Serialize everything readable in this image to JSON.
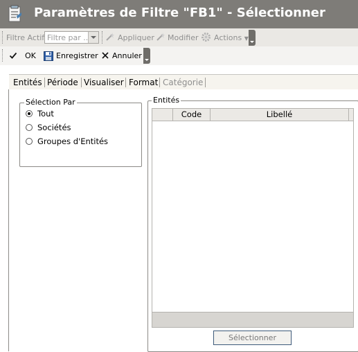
{
  "window": {
    "title": "Paramètres de Filtre \"FB1\" - Sélectionner"
  },
  "toolbar1": {
    "filter_label": "Filtre Actif",
    "filter_combo": {
      "value": "Filtre par ..."
    },
    "apply_label": "Appliquer",
    "modify_label": "Modifier",
    "actions_label": "Actions"
  },
  "toolbar2": {
    "ok_label": "OK",
    "save_label": "Enregistrer",
    "cancel_label": "Annuler"
  },
  "tabs": [
    {
      "label": "Entités",
      "active": true
    },
    {
      "label": "Période",
      "active": false
    },
    {
      "label": "Visualiser",
      "active": false
    },
    {
      "label": "Format",
      "active": false
    },
    {
      "label": "Catégorie",
      "active": false,
      "disabled": true
    }
  ],
  "selection_group": {
    "legend": "Sélection Par",
    "options": [
      {
        "label": "Tout",
        "checked": true
      },
      {
        "label": "Sociétés",
        "checked": false
      },
      {
        "label": "Groupes d'Entités",
        "checked": false
      }
    ]
  },
  "entities_group": {
    "legend": "Entités",
    "columns": [
      "",
      "Code",
      "Libellé"
    ],
    "rows": [],
    "select_button": "Sélectionner"
  },
  "colors": {
    "titlebar": "#7e7c78",
    "toolbar": "#eae8e4",
    "accent_border": "#3d5a7a"
  },
  "icons": {
    "title": "settings-window-icon",
    "apply": "magic-wand-icon",
    "modify": "magic-wand-icon",
    "actions": "gear-icon",
    "ok": "checkmark-icon",
    "save": "floppy-disk-icon",
    "cancel": "close-icon"
  }
}
